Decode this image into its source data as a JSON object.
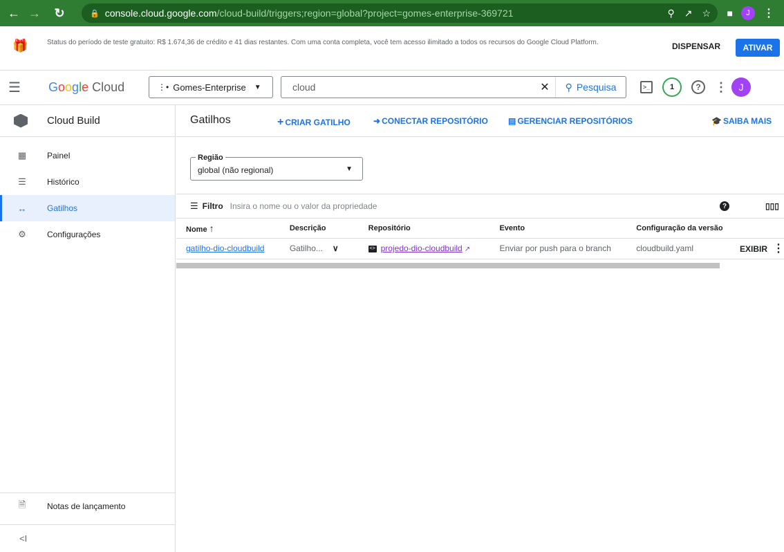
{
  "browser": {
    "url_host": "console.cloud.google.com",
    "url_path": "/cloud-build/triggers;region=global?project=gomes-enterprise-369721",
    "avatar": "J"
  },
  "banner": {
    "text": "Status do período de teste gratuito: R$ 1.674,36 de crédito e 41 dias restantes. Com uma conta completa, você tem acesso ilimitado a todos os recursos do Google Cloud Platform.",
    "dismiss": "DISPENSAR",
    "activate": "ATIVAR"
  },
  "topbar": {
    "logo_google": "Google",
    "logo_cloud": "Cloud",
    "project": "Gomes-Enterprise",
    "search_value": "cloud",
    "search_button": "Pesquisa",
    "notification_count": "1",
    "avatar": "J"
  },
  "sidebar": {
    "title": "Cloud Build",
    "items": [
      {
        "label": "Painel"
      },
      {
        "label": "Histórico"
      },
      {
        "label": "Gatilhos"
      },
      {
        "label": "Configurações"
      }
    ],
    "footer_label": "Notas de lançamento",
    "collapse": "<I"
  },
  "main": {
    "title": "Gatilhos",
    "actions": {
      "create": "CRIAR GATILHO",
      "connect": "CONECTAR REPOSITÓRIO",
      "manage": "GERENCIAR REPOSITÓRIOS",
      "learn": "SAIBA MAIS"
    },
    "region": {
      "label": "Região",
      "value": "global (não regional)"
    },
    "filter": {
      "label": "Filtro",
      "placeholder": "Insira o nome ou o valor da propriedade"
    },
    "table": {
      "columns": [
        "Nome",
        "Descrição",
        "Repositório",
        "Evento",
        "Configuração da versão"
      ],
      "rows": [
        {
          "name": "gatilho-dio-cloudbuild",
          "description": "Gatilho...",
          "repository": "projedo-dio-cloudbuild",
          "event": "Enviar por push para o branch",
          "config": "cloudbuild.yaml",
          "action": "EXIBIR"
        }
      ]
    }
  },
  "colors": {
    "browser_bar": "#2e7d32",
    "accent": "#1a73e8",
    "avatar": "#a142f4"
  }
}
